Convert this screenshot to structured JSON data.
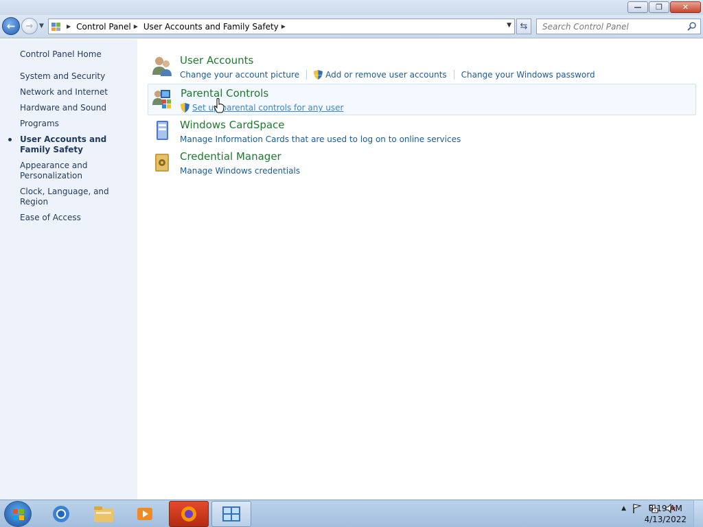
{
  "window": {
    "minimize_label": "—",
    "restore_label": "❐",
    "close_label": "✕"
  },
  "navbar": {
    "breadcrumbs": [
      "Control Panel",
      "User Accounts and Family Safety"
    ],
    "search_placeholder": "Search Control Panel"
  },
  "sidebar": {
    "home": "Control Panel Home",
    "items": [
      {
        "label": "System and Security"
      },
      {
        "label": "Network and Internet"
      },
      {
        "label": "Hardware and Sound"
      },
      {
        "label": "Programs"
      },
      {
        "label": "User Accounts and Family Safety",
        "active": true
      },
      {
        "label": "Appearance and Personalization"
      },
      {
        "label": "Clock, Language, and Region"
      },
      {
        "label": "Ease of Access"
      }
    ]
  },
  "main": {
    "categories": [
      {
        "title": "User Accounts",
        "icon": "users-icon",
        "links": [
          "Change your account picture",
          "Add or remove user accounts",
          "Change your Windows password"
        ]
      },
      {
        "title": "Parental Controls",
        "icon": "parental-controls-icon",
        "links": [
          "Set up parental controls for any user"
        ]
      },
      {
        "title": "Windows CardSpace",
        "icon": "cardspace-icon",
        "links": [
          "Manage Information Cards that are used to log on to online services"
        ]
      },
      {
        "title": "Credential Manager",
        "icon": "credential-vault-icon",
        "links": [
          "Manage Windows credentials"
        ]
      }
    ]
  },
  "taskbar": {
    "apps": [
      "chrome-icon",
      "file-explorer-icon",
      "media-player-icon",
      "firefox-icon",
      "control-panel-icon"
    ],
    "clock_time": "8:19 AM",
    "clock_date": "4/13/2022"
  },
  "colors": {
    "category_title": "#1e7a2f",
    "link": "#1a5b9a",
    "sidebar_bg": "#eef3fb"
  }
}
